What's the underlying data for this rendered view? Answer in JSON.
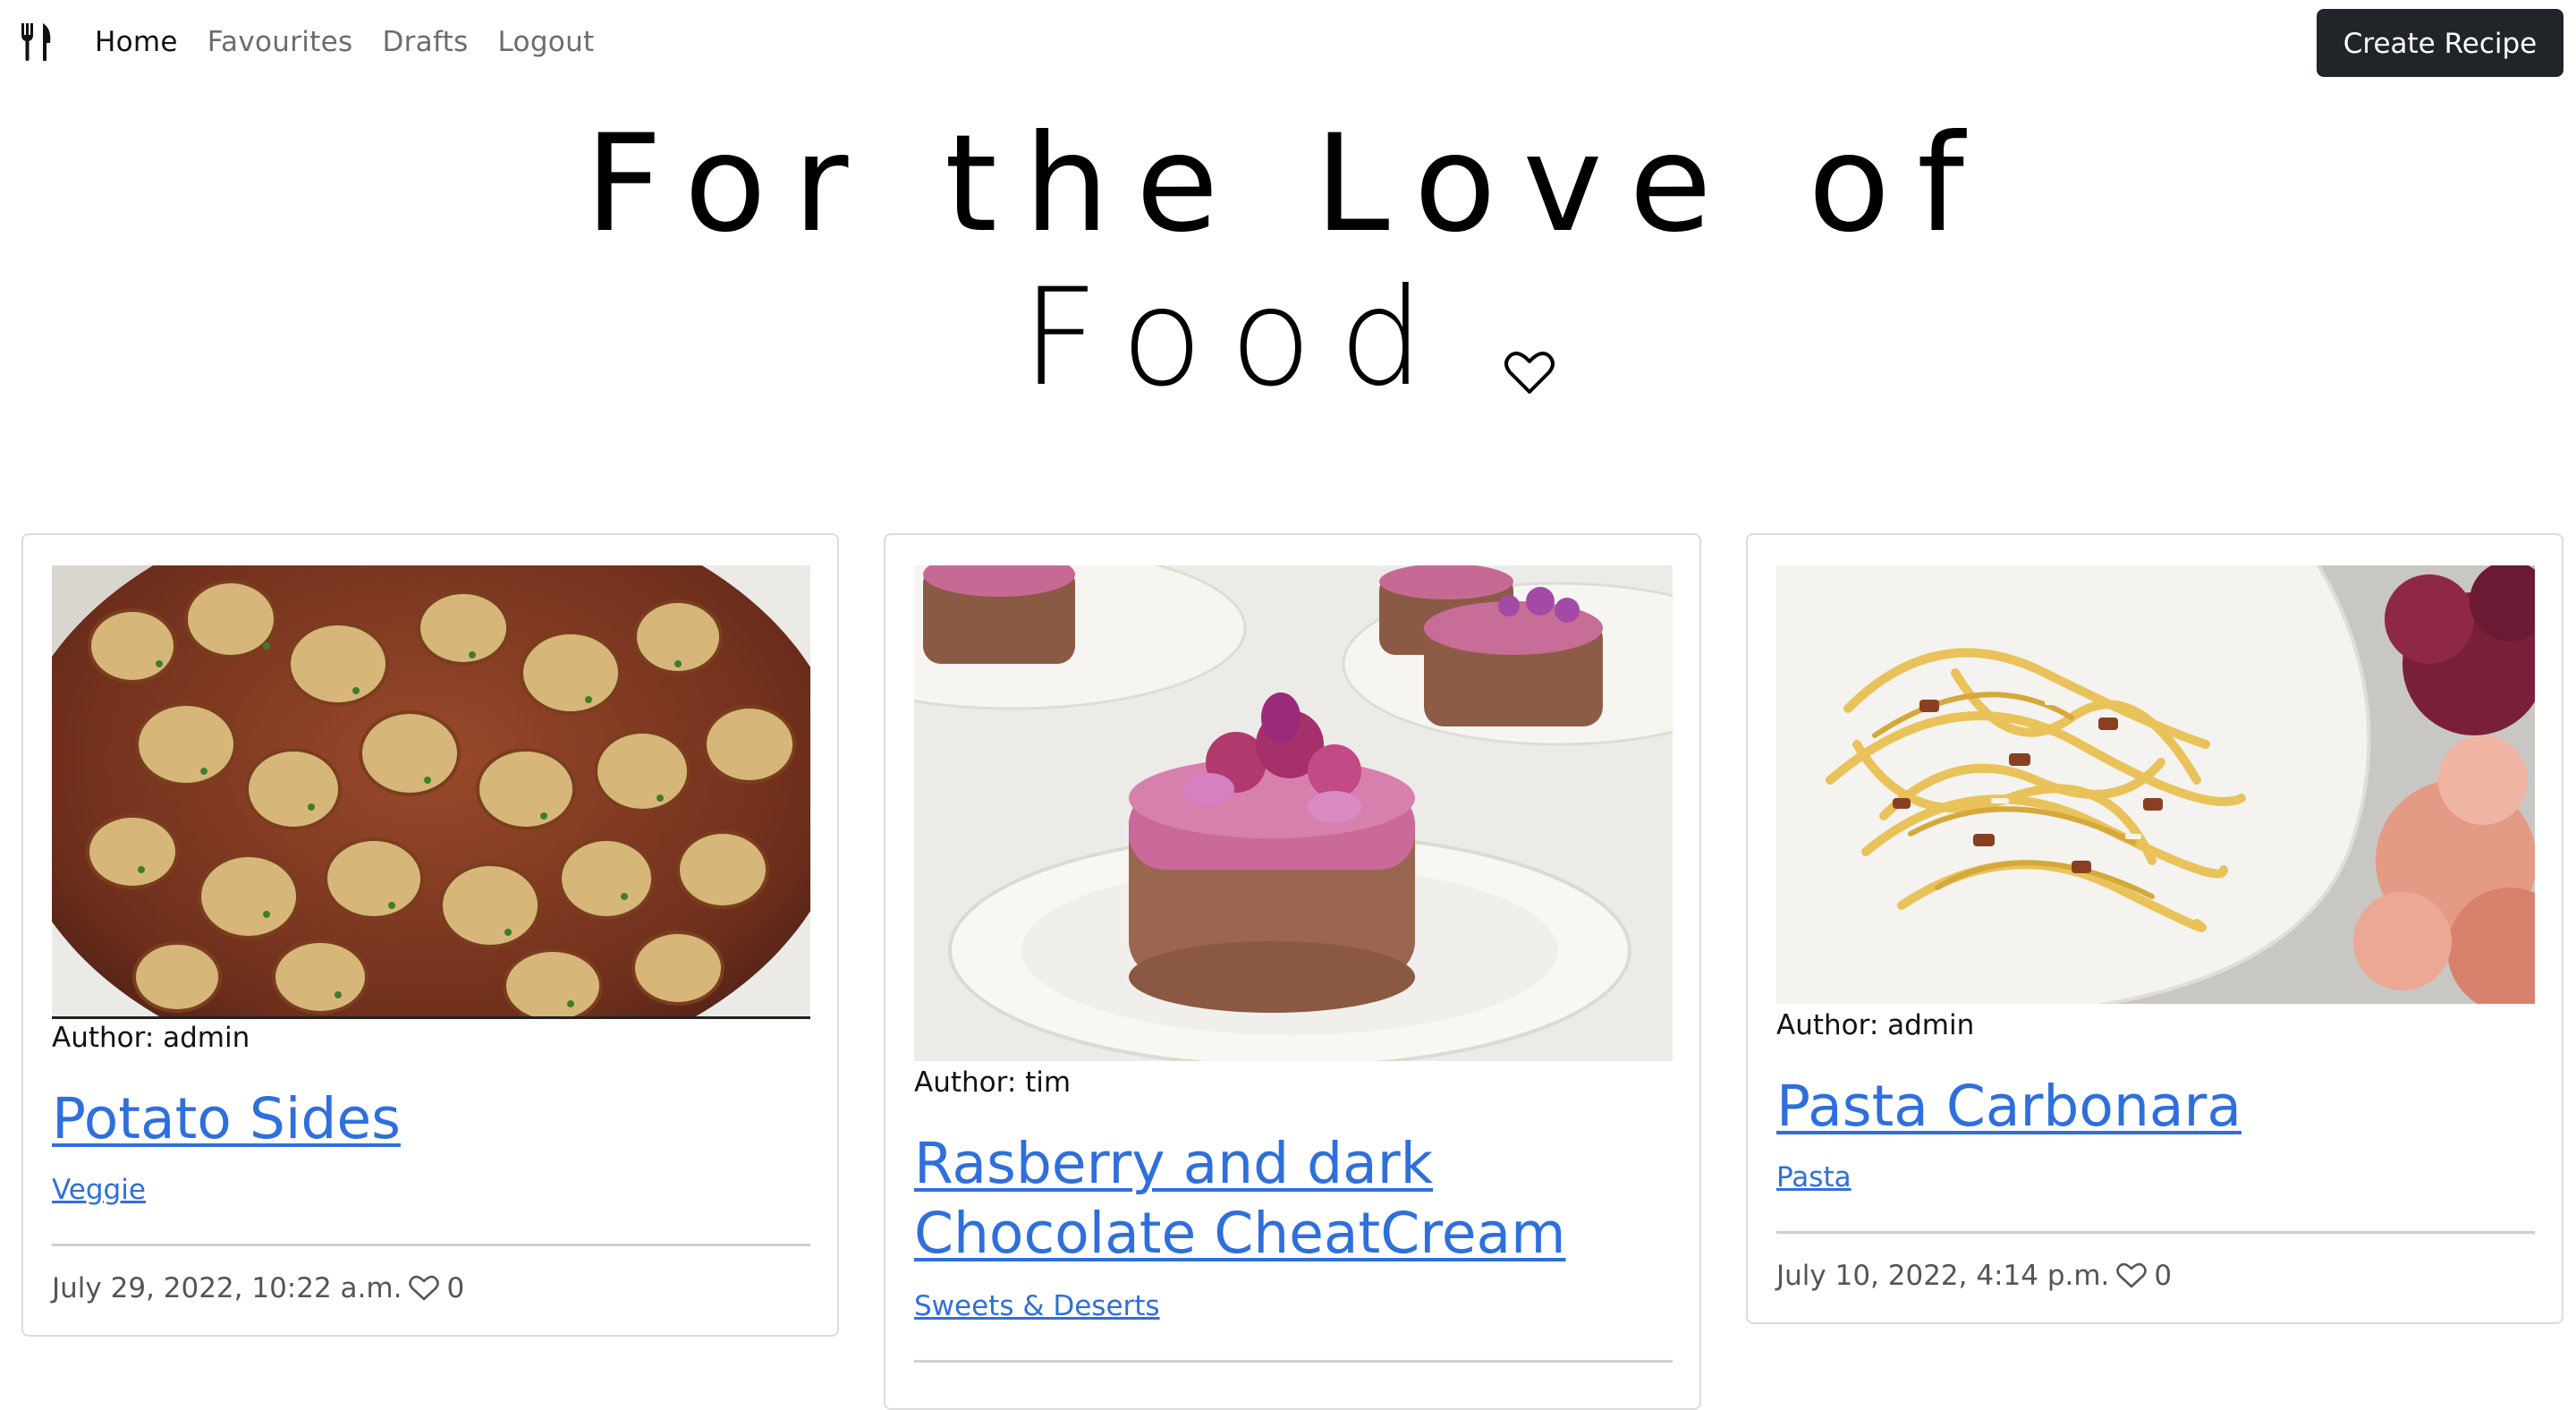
{
  "nav": {
    "brand_icon": "fork-knife-icon",
    "links": [
      "Home",
      "Favourites",
      "Drafts",
      "Logout"
    ],
    "active": "Home",
    "create_button": "Create Recipe"
  },
  "hero": {
    "line1": "For the Love of",
    "line2": "Food",
    "icon": "heart-outline-icon"
  },
  "colors": {
    "link": "#2f6fdc",
    "button_bg": "#212529",
    "nav_inactive": "#6c6c6c"
  },
  "recipes": [
    {
      "author": "Author: admin",
      "title": "Potato Sides",
      "category": "Veggie",
      "date": "July 29, 2022, 10:22 a.m.",
      "likes": "0"
    },
    {
      "author": "Author: tim",
      "title": "Rasberry and dark Chocolate CheatCream",
      "category": "Sweets & Deserts"
    },
    {
      "author": "Author: admin",
      "title": "Pasta Carbonara",
      "category": "Pasta",
      "date": "July 10, 2022, 4:14 p.m.",
      "likes": "0"
    }
  ]
}
